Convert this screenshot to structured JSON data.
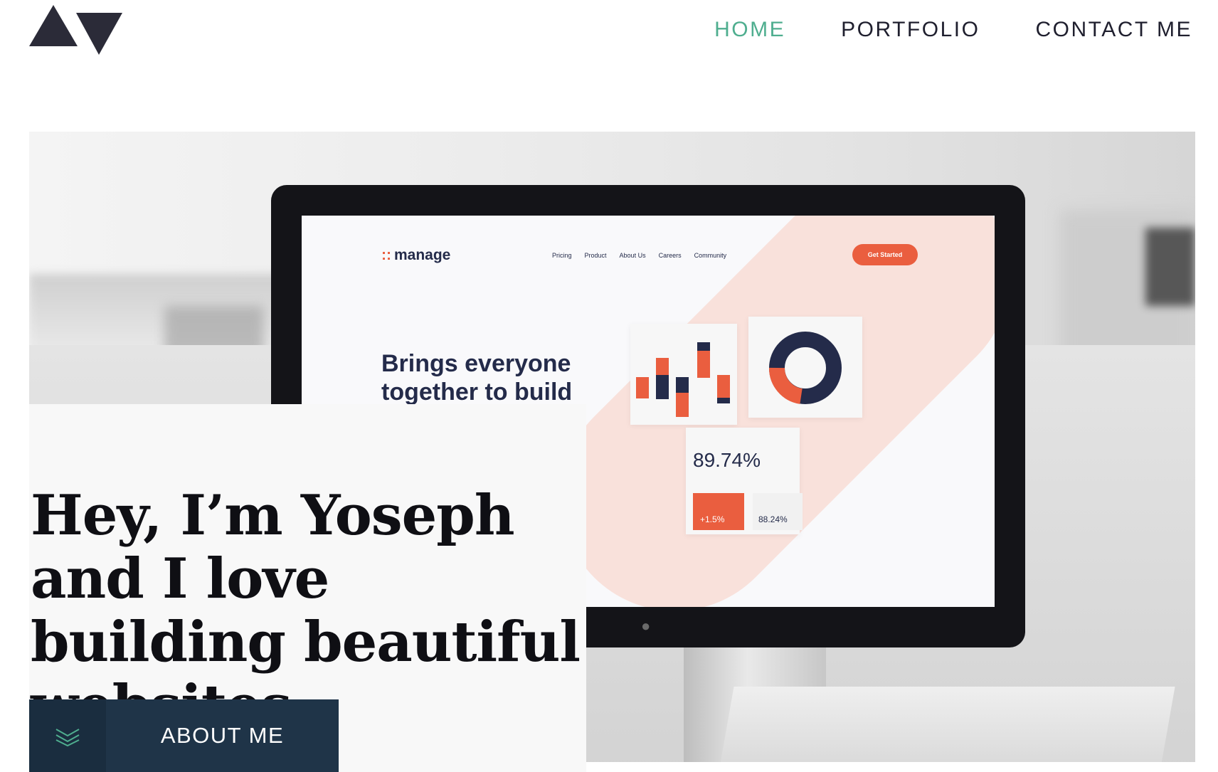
{
  "header": {
    "logo_icon": "av-triangles-logo",
    "nav": [
      {
        "label": "HOME",
        "active": true
      },
      {
        "label": "PORTFOLIO",
        "active": false
      },
      {
        "label": "CONTACT ME",
        "active": false
      }
    ]
  },
  "hero": {
    "screen": {
      "brand": "manage",
      "nav": [
        "Pricing",
        "Product",
        "About Us",
        "Careers",
        "Community"
      ],
      "cta": "Get Started",
      "headline": "Brings everyone together to build",
      "stat": "89.74%",
      "delta": "+1.5%",
      "sub_stat": "88.24%"
    }
  },
  "intro": {
    "headline": "Hey, I’m Yoseph and I love building beautiful websites"
  },
  "about_button": {
    "label": "ABOUT ME",
    "icon": "double-chevron-down-icon"
  },
  "colors": {
    "accent": "#4fae8f",
    "button_bg": "#1f3448",
    "text": "#1f1f2e",
    "screen_orange": "#ea5e3f",
    "screen_navy": "#242b4a"
  }
}
